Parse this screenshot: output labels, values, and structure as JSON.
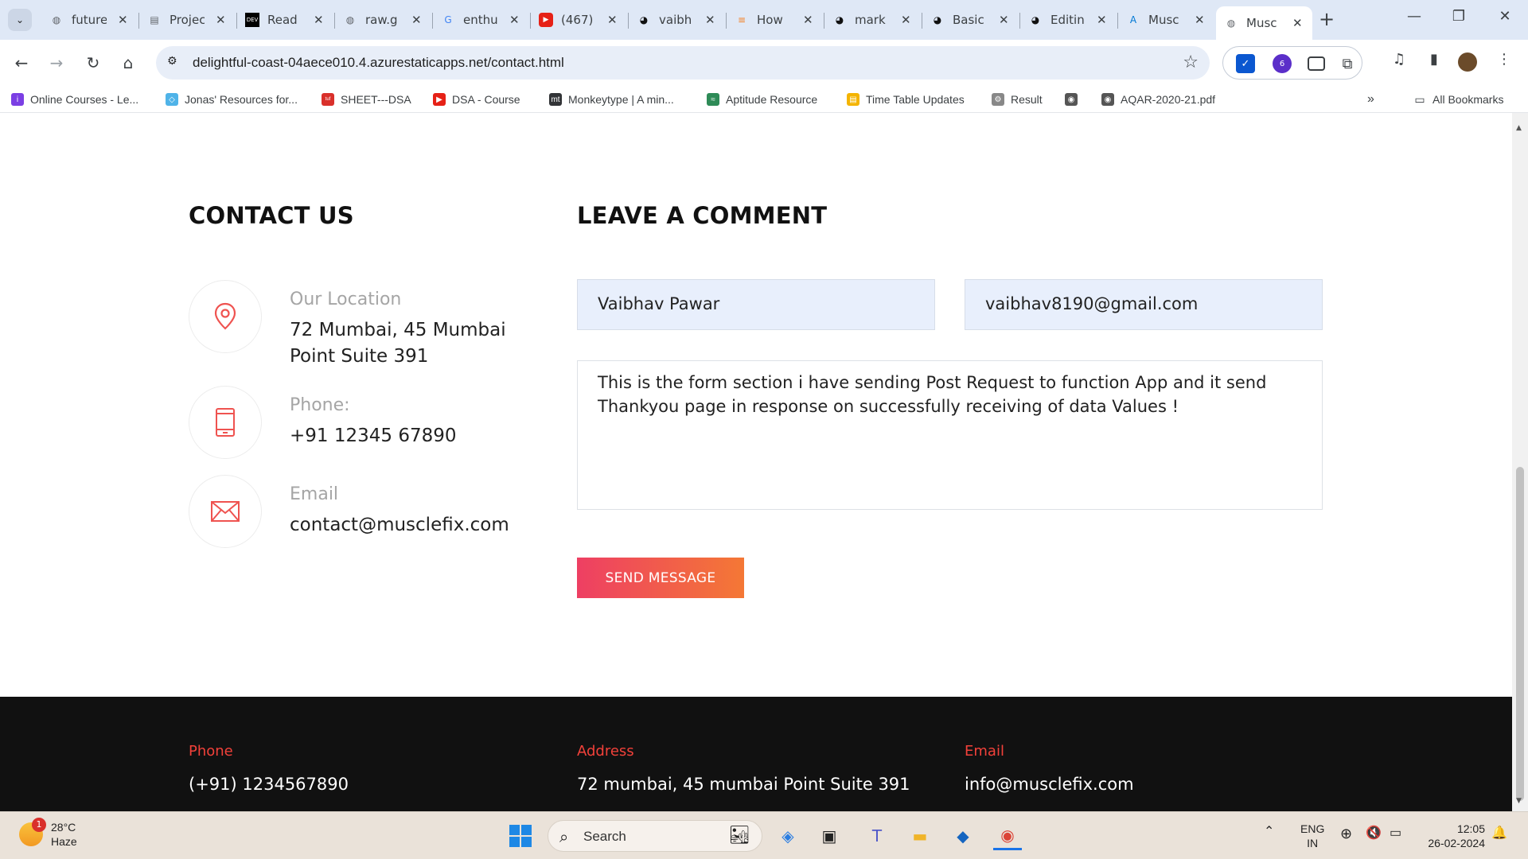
{
  "tabs": [
    {
      "title": "future",
      "icon": "globe-icon"
    },
    {
      "title": "Projects",
      "icon": "document-icon"
    },
    {
      "title": "Read",
      "icon": "dev-icon"
    },
    {
      "title": "raw.g",
      "icon": "globe-icon"
    },
    {
      "title": "enthu",
      "icon": "google-icon"
    },
    {
      "title": "(467)",
      "icon": "youtube-icon"
    },
    {
      "title": "vaibh",
      "icon": "github-icon"
    },
    {
      "title": "How",
      "icon": "stack-icon"
    },
    {
      "title": "mark",
      "icon": "github-icon"
    },
    {
      "title": "Basic",
      "icon": "github-icon"
    },
    {
      "title": "Editin",
      "icon": "github-icon"
    },
    {
      "title": "Musc",
      "icon": "azure-icon"
    },
    {
      "title": "Musc",
      "icon": "globe-icon"
    }
  ],
  "address": {
    "url": "delightful-coast-04aece010.4.azurestaticapps.net/contact.html"
  },
  "extensions": {
    "badge": "6"
  },
  "bookmarks": [
    {
      "label": "Online Courses - Le...",
      "color": "#7b3fe4",
      "glyph": "i"
    },
    {
      "label": "Jonas' Resources for...",
      "color": "#4fb3e8",
      "glyph": "◇"
    },
    {
      "label": "SHEET---DSA",
      "color": "#d9302b",
      "glyph": "tuf"
    },
    {
      "label": "DSA - Course",
      "color": "#e62117",
      "glyph": "▶"
    },
    {
      "label": "Monkeytype | A min...",
      "color": "#323437",
      "glyph": "mt"
    },
    {
      "label": "Aptitude Resource",
      "color": "#2e8b57",
      "glyph": "≈"
    },
    {
      "label": "Time Table Updates",
      "color": "#f4b400",
      "glyph": "▤"
    },
    {
      "label": "Result",
      "color": "#888888",
      "glyph": "⚙"
    },
    {
      "label": "",
      "color": "#555555",
      "glyph": "◉"
    },
    {
      "label": "AQAR-2020-21.pdf",
      "color": "#555555",
      "glyph": "◉"
    }
  ],
  "bookmarks_all": "All Bookmarks",
  "contact": {
    "heading": "CONTACT US",
    "items": [
      {
        "label": "Our Location",
        "value": "72 Mumbai, 45 Mumbai Point Suite 391"
      },
      {
        "label": "Phone:",
        "value": "+91 12345 67890"
      },
      {
        "label": "Email",
        "value": "contact@musclefix.com"
      }
    ]
  },
  "comment": {
    "heading": "LEAVE A COMMENT",
    "name_value": "Vaibhav Pawar",
    "email_value": "vaibhav8190@gmail.com",
    "message_value": "This is the form section i have sending Post Request to function App and it send Thankyou page in response on successfully receiving of data Values !",
    "send_label": "SEND MESSAGE"
  },
  "footer": {
    "phone_label": "Phone",
    "phone_value": "(+91) 1234567890",
    "address_label": "Address",
    "address_value": "72 mumbai, 45 mumbai Point Suite 391",
    "email_label": "Email",
    "email_value": "info@musclefix.com"
  },
  "taskbar": {
    "weather_temp": "28°C",
    "weather_desc": "Haze",
    "weather_badge": "1",
    "search_placeholder": "Search",
    "lang_top": "ENG",
    "lang_bottom": "IN",
    "time": "12:05",
    "date": "26-02-2024"
  },
  "colors": {
    "accent_gradient_start": "#ee3f63",
    "accent_gradient_end": "#f47835",
    "footer_label": "#f2413a",
    "icon_red": "#ef5350"
  }
}
